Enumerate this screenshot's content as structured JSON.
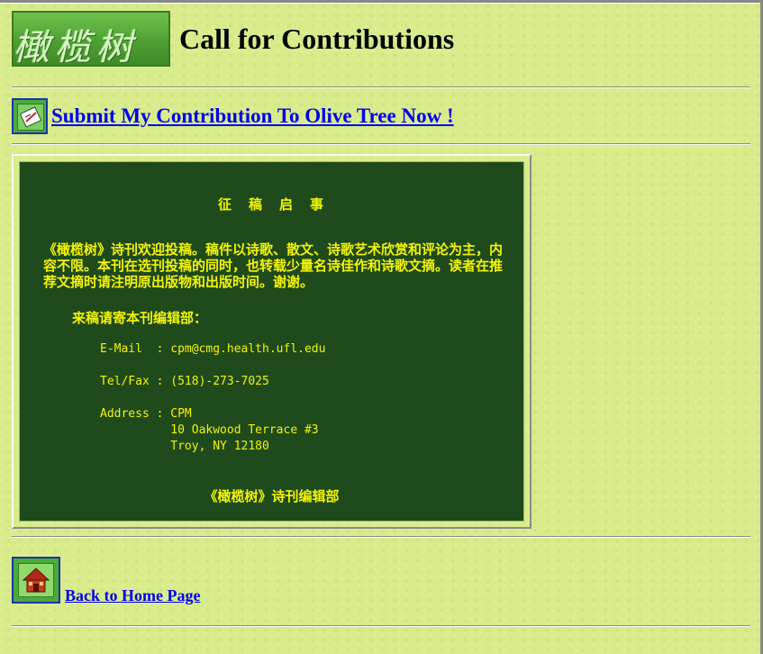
{
  "header": {
    "logo_text": "橄榄树",
    "title": "Call for Contributions"
  },
  "submit": {
    "icon": "pencil-document-icon",
    "link_text": "Submit My Contribution To Olive Tree Now !"
  },
  "notice": {
    "heading": "征　稿　启　事",
    "body": "《橄榄树》诗刊欢迎投稿。稿件以诗歌、散文、诗歌艺术欣赏和评论为主，内容不限。本刊在选刊投稿的同时，也转载少量名诗佳作和诗歌文摘。读者在推荐文摘时请注明原出版物和出版时间。谢谢。",
    "send_to": "来稿请寄本刊编辑部：",
    "email_line": "E-Mail  : cpm@cmg.health.ufl.edu",
    "tel_line": "Tel/Fax : (518)-273-7025",
    "address_line1": "Address : CPM",
    "address_line2": "          10 Oakwood Terrace #3",
    "address_line3": "          Troy, NY 12180",
    "signature": "《橄榄树》诗刊编辑部"
  },
  "footer": {
    "home_icon": "house-icon",
    "home_link": "Back to Home Page"
  },
  "colors": {
    "background": "#d9ec8c",
    "panel_bg": "#1f4a1c",
    "panel_text": "#f4f400",
    "link": "#0000ee"
  }
}
